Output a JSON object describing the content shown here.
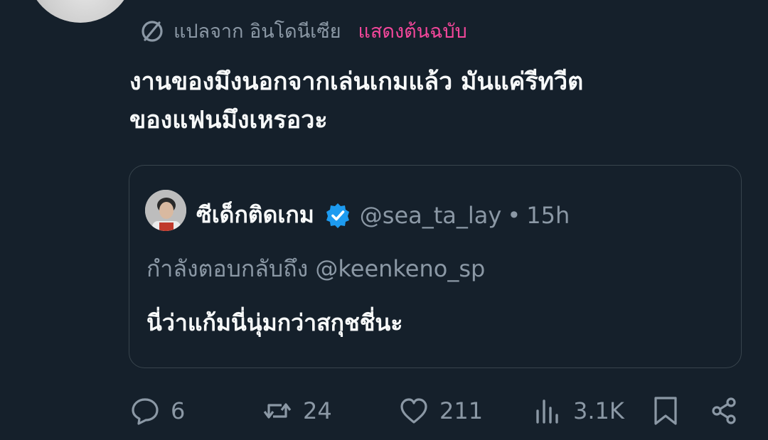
{
  "translation": {
    "source_label": "แปลจาก อินโดนีเซีย",
    "show_original_label": "แสดงต้นฉบับ"
  },
  "tweet": {
    "text": "งานของมึงนอกจากเล่นเกมแล้ว มันแค่รีทวีต\nของแฟนมึงเหรอวะ"
  },
  "quoted_tweet": {
    "display_name": "ซีเด็กติดเกม",
    "handle": "@sea_ta_lay",
    "separator": "•",
    "time": "15h",
    "reply_to": "กำลังตอบกลับถึง @keenkeno_sp",
    "text": "นี่ว่าแก้มนี่นุ่มกว่าสกุชชี่นะ"
  },
  "actions": {
    "replies": "6",
    "retweets": "24",
    "likes": "211",
    "views": "3.1K"
  },
  "colors": {
    "background": "#15202b",
    "text_primary": "#f7f9f9",
    "text_secondary": "#8b98a5",
    "accent_pink": "#f4479b",
    "verified_blue": "#1d9bf0",
    "border": "#38444d"
  },
  "icons": [
    "globe-icon",
    "verified-icon",
    "reply-icon",
    "retweet-icon",
    "like-icon",
    "views-icon",
    "bookmark-icon",
    "share-icon"
  ]
}
